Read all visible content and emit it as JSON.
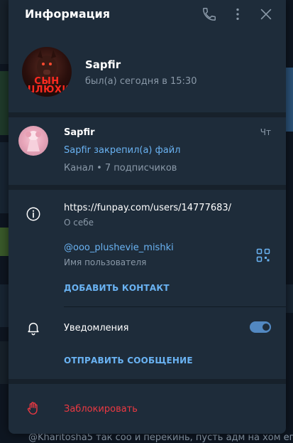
{
  "background": {
    "last_message": "@Kharitosha5  так соо и перекинь, пусть адм на хом ег..."
  },
  "header": {
    "title": "Информация",
    "icons": [
      "phone-icon",
      "more-vertical-icon",
      "close-icon"
    ]
  },
  "profile": {
    "name": "Sapfir",
    "status": "был(а) сегодня в 15:30",
    "avatar_text": "СЫН\nШЛЮХИ"
  },
  "channel": {
    "name": "Sapfir",
    "day": "Чт",
    "last_message": "Sapfir закрепил(а) файл",
    "subtitle": "Канал • 7 подписчиков"
  },
  "info": {
    "link": "https://funpay.com/users/14777683/",
    "link_label": "О себе",
    "username": "@ooo_plushevie_mishki",
    "username_label": "Имя пользователя",
    "add_contact": "ДОБАВИТЬ КОНТАКТ",
    "notifications_label": "Уведомления",
    "notifications_on": true,
    "send_message": "ОТПРАВИТЬ СООБЩЕНИЕ"
  },
  "block": {
    "label": "Заблокировать"
  },
  "colors": {
    "panel_bg": "#1e2c3a",
    "divider": "#17212b",
    "accent": "#6ab3f3",
    "toggle": "#5288c1",
    "danger": "#ec3942",
    "muted": "#8a99a8"
  }
}
